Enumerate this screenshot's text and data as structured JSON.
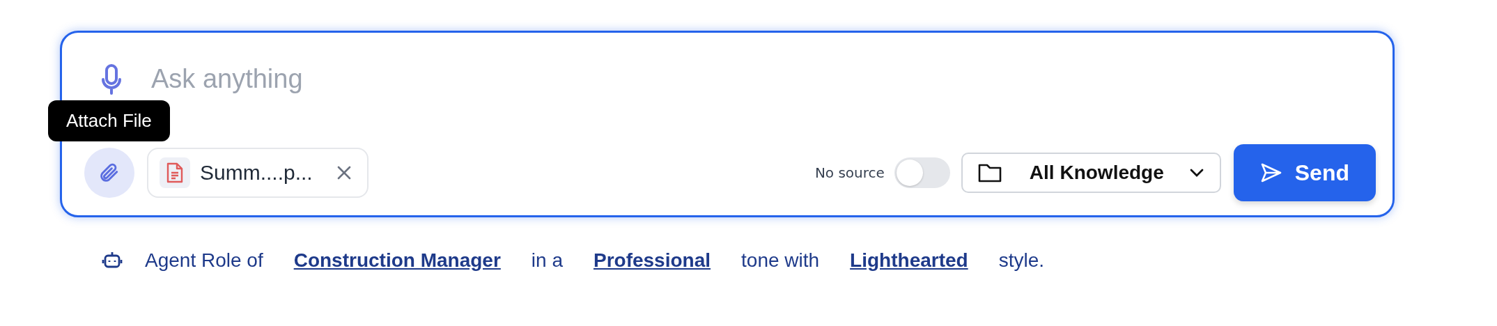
{
  "composer": {
    "placeholder": "Ask anything",
    "tooltip": "Attach File",
    "attachments": [
      {
        "name": "Summ....p..."
      }
    ],
    "source_toggle": {
      "label": "No source",
      "on": false
    },
    "knowledge_dropdown": {
      "value": "All Knowledge"
    },
    "send_button": "Send"
  },
  "agent_line": [
    {
      "kind": "text",
      "text": "Agent Role of"
    },
    {
      "kind": "link",
      "text": "Construction Manager"
    },
    {
      "kind": "text",
      "text": "in a"
    },
    {
      "kind": "link",
      "text": "Professional"
    },
    {
      "kind": "text",
      "text": "tone with"
    },
    {
      "kind": "link",
      "text": "Lighthearted"
    },
    {
      "kind": "text",
      "text": "style."
    }
  ]
}
